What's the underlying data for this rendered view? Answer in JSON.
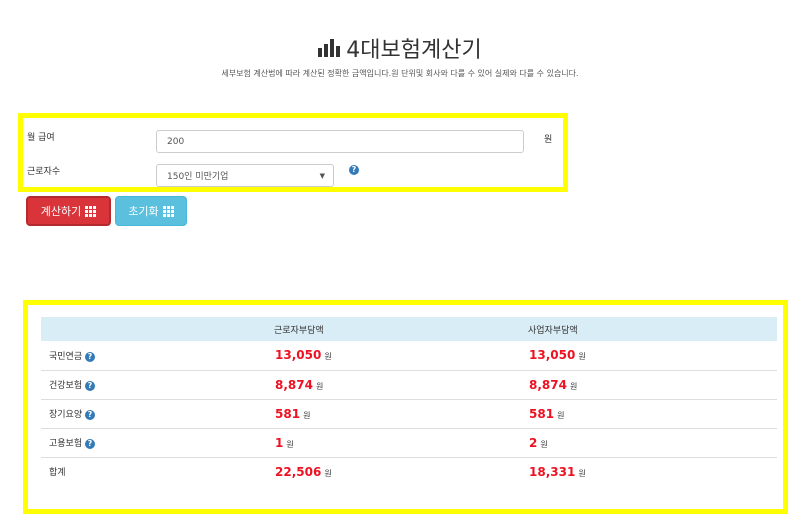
{
  "header": {
    "title": "4대보험계산기",
    "subtitle": "세부보험 계산법에 따라 계산된 정확한 금액입니다.원 단위및 회사와 다를 수 있어 실제와 다를 수 있습니다."
  },
  "form": {
    "salary_label": "월 급여",
    "salary_value": "200",
    "salary_unit": "원",
    "workers_label": "근로자수",
    "workers_selected": "150인 미만기업"
  },
  "buttons": {
    "calc_label": "계산하기",
    "reset_label": "초기화"
  },
  "results": {
    "col_employee": "근로자부담액",
    "col_employer": "사업자부담액",
    "unit": "원",
    "rows": [
      {
        "label": "국민연금",
        "employee": "13,050",
        "employer": "13,050"
      },
      {
        "label": "건강보험",
        "employee": "8,874",
        "employer": "8,874"
      },
      {
        "label": "장기요양",
        "employee": "581",
        "employer": "581"
      },
      {
        "label": "고용보험",
        "employee": "1",
        "employer": "2"
      },
      {
        "label": "합계",
        "employee": "22,506",
        "employer": "18,331"
      }
    ]
  },
  "colors": {
    "accent_red": "#d9343a",
    "accent_cyan": "#5bc0de",
    "highlight_yellow": "#ffff00",
    "value_red": "#ee1122",
    "table_header": "#d9edf7"
  },
  "icons": [
    "bar-chart-icon",
    "help-icon",
    "grid-icon"
  ]
}
